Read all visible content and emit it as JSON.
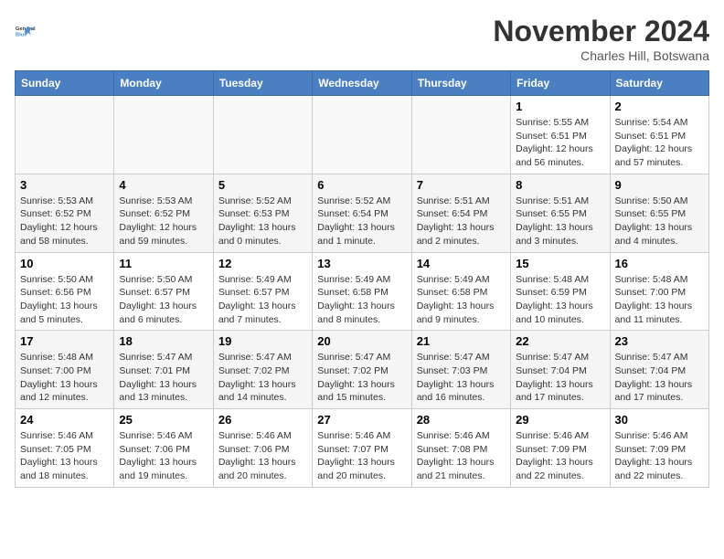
{
  "logo": {
    "line1": "General",
    "line2": "Blue"
  },
  "title": "November 2024",
  "location": "Charles Hill, Botswana",
  "days_of_week": [
    "Sunday",
    "Monday",
    "Tuesday",
    "Wednesday",
    "Thursday",
    "Friday",
    "Saturday"
  ],
  "weeks": [
    [
      {
        "day": "",
        "info": ""
      },
      {
        "day": "",
        "info": ""
      },
      {
        "day": "",
        "info": ""
      },
      {
        "day": "",
        "info": ""
      },
      {
        "day": "",
        "info": ""
      },
      {
        "day": "1",
        "info": "Sunrise: 5:55 AM\nSunset: 6:51 PM\nDaylight: 12 hours\nand 56 minutes."
      },
      {
        "day": "2",
        "info": "Sunrise: 5:54 AM\nSunset: 6:51 PM\nDaylight: 12 hours\nand 57 minutes."
      }
    ],
    [
      {
        "day": "3",
        "info": "Sunrise: 5:53 AM\nSunset: 6:52 PM\nDaylight: 12 hours\nand 58 minutes."
      },
      {
        "day": "4",
        "info": "Sunrise: 5:53 AM\nSunset: 6:52 PM\nDaylight: 12 hours\nand 59 minutes."
      },
      {
        "day": "5",
        "info": "Sunrise: 5:52 AM\nSunset: 6:53 PM\nDaylight: 13 hours\nand 0 minutes."
      },
      {
        "day": "6",
        "info": "Sunrise: 5:52 AM\nSunset: 6:54 PM\nDaylight: 13 hours\nand 1 minute."
      },
      {
        "day": "7",
        "info": "Sunrise: 5:51 AM\nSunset: 6:54 PM\nDaylight: 13 hours\nand 2 minutes."
      },
      {
        "day": "8",
        "info": "Sunrise: 5:51 AM\nSunset: 6:55 PM\nDaylight: 13 hours\nand 3 minutes."
      },
      {
        "day": "9",
        "info": "Sunrise: 5:50 AM\nSunset: 6:55 PM\nDaylight: 13 hours\nand 4 minutes."
      }
    ],
    [
      {
        "day": "10",
        "info": "Sunrise: 5:50 AM\nSunset: 6:56 PM\nDaylight: 13 hours\nand 5 minutes."
      },
      {
        "day": "11",
        "info": "Sunrise: 5:50 AM\nSunset: 6:57 PM\nDaylight: 13 hours\nand 6 minutes."
      },
      {
        "day": "12",
        "info": "Sunrise: 5:49 AM\nSunset: 6:57 PM\nDaylight: 13 hours\nand 7 minutes."
      },
      {
        "day": "13",
        "info": "Sunrise: 5:49 AM\nSunset: 6:58 PM\nDaylight: 13 hours\nand 8 minutes."
      },
      {
        "day": "14",
        "info": "Sunrise: 5:49 AM\nSunset: 6:58 PM\nDaylight: 13 hours\nand 9 minutes."
      },
      {
        "day": "15",
        "info": "Sunrise: 5:48 AM\nSunset: 6:59 PM\nDaylight: 13 hours\nand 10 minutes."
      },
      {
        "day": "16",
        "info": "Sunrise: 5:48 AM\nSunset: 7:00 PM\nDaylight: 13 hours\nand 11 minutes."
      }
    ],
    [
      {
        "day": "17",
        "info": "Sunrise: 5:48 AM\nSunset: 7:00 PM\nDaylight: 13 hours\nand 12 minutes."
      },
      {
        "day": "18",
        "info": "Sunrise: 5:47 AM\nSunset: 7:01 PM\nDaylight: 13 hours\nand 13 minutes."
      },
      {
        "day": "19",
        "info": "Sunrise: 5:47 AM\nSunset: 7:02 PM\nDaylight: 13 hours\nand 14 minutes."
      },
      {
        "day": "20",
        "info": "Sunrise: 5:47 AM\nSunset: 7:02 PM\nDaylight: 13 hours\nand 15 minutes."
      },
      {
        "day": "21",
        "info": "Sunrise: 5:47 AM\nSunset: 7:03 PM\nDaylight: 13 hours\nand 16 minutes."
      },
      {
        "day": "22",
        "info": "Sunrise: 5:47 AM\nSunset: 7:04 PM\nDaylight: 13 hours\nand 17 minutes."
      },
      {
        "day": "23",
        "info": "Sunrise: 5:47 AM\nSunset: 7:04 PM\nDaylight: 13 hours\nand 17 minutes."
      }
    ],
    [
      {
        "day": "24",
        "info": "Sunrise: 5:46 AM\nSunset: 7:05 PM\nDaylight: 13 hours\nand 18 minutes."
      },
      {
        "day": "25",
        "info": "Sunrise: 5:46 AM\nSunset: 7:06 PM\nDaylight: 13 hours\nand 19 minutes."
      },
      {
        "day": "26",
        "info": "Sunrise: 5:46 AM\nSunset: 7:06 PM\nDaylight: 13 hours\nand 20 minutes."
      },
      {
        "day": "27",
        "info": "Sunrise: 5:46 AM\nSunset: 7:07 PM\nDaylight: 13 hours\nand 20 minutes."
      },
      {
        "day": "28",
        "info": "Sunrise: 5:46 AM\nSunset: 7:08 PM\nDaylight: 13 hours\nand 21 minutes."
      },
      {
        "day": "29",
        "info": "Sunrise: 5:46 AM\nSunset: 7:09 PM\nDaylight: 13 hours\nand 22 minutes."
      },
      {
        "day": "30",
        "info": "Sunrise: 5:46 AM\nSunset: 7:09 PM\nDaylight: 13 hours\nand 22 minutes."
      }
    ]
  ]
}
